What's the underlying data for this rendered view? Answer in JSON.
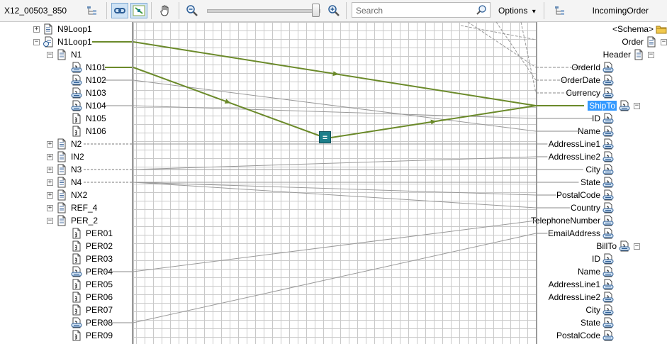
{
  "toolbar": {
    "source_schema": "X12_00503_850",
    "target_schema": "IncomingOrder",
    "search_placeholder": "Search",
    "options_label": "Options",
    "options_caret": "▾"
  },
  "source_tree": [
    {
      "label": "N9Loop1",
      "expander": "+",
      "icon": "record-icon"
    },
    {
      "label": "N1Loop1",
      "expander": "−",
      "icon": "loop-record-icon"
    },
    {
      "label": "N1",
      "expander": "−",
      "icon": "record-icon"
    },
    {
      "label": "N101",
      "expander": "",
      "icon": "linked-field-icon"
    },
    {
      "label": "N102",
      "expander": "",
      "icon": "linked-field-icon"
    },
    {
      "label": "N103",
      "expander": "",
      "icon": "linked-field-icon"
    },
    {
      "label": "N104",
      "expander": "",
      "icon": "linked-field-icon"
    },
    {
      "label": "N105",
      "expander": "",
      "icon": "field-icon"
    },
    {
      "label": "N106",
      "expander": "",
      "icon": "field-icon"
    },
    {
      "label": "N2",
      "expander": "+",
      "icon": "record-icon"
    },
    {
      "label": "IN2",
      "expander": "+",
      "icon": "record-icon"
    },
    {
      "label": "N3",
      "expander": "+",
      "icon": "record-icon"
    },
    {
      "label": "N4",
      "expander": "+",
      "icon": "record-icon"
    },
    {
      "label": "NX2",
      "expander": "+",
      "icon": "record-icon"
    },
    {
      "label": "REF_4",
      "expander": "+",
      "icon": "record-icon"
    },
    {
      "label": "PER_2",
      "expander": "−",
      "icon": "record-icon"
    },
    {
      "label": "PER01",
      "expander": "",
      "icon": "field-icon"
    },
    {
      "label": "PER02",
      "expander": "",
      "icon": "field-icon"
    },
    {
      "label": "PER03",
      "expander": "",
      "icon": "field-icon"
    },
    {
      "label": "PER04",
      "expander": "",
      "icon": "linked-field-icon"
    },
    {
      "label": "PER05",
      "expander": "",
      "icon": "field-icon"
    },
    {
      "label": "PER06",
      "expander": "",
      "icon": "field-icon"
    },
    {
      "label": "PER07",
      "expander": "",
      "icon": "field-icon"
    },
    {
      "label": "PER08",
      "expander": "",
      "icon": "linked-field-icon"
    },
    {
      "label": "PER09",
      "expander": "",
      "icon": "field-icon"
    }
  ],
  "target_tree": [
    {
      "label": "<Schema>",
      "kind": "schema",
      "expander": ""
    },
    {
      "label": "Order",
      "kind": "record",
      "expander": "−"
    },
    {
      "label": "Header",
      "kind": "record",
      "expander": "−"
    },
    {
      "label": "OrderId",
      "kind": "field",
      "expander": ""
    },
    {
      "label": "OrderDate",
      "kind": "field",
      "expander": ""
    },
    {
      "label": "Currency",
      "kind": "field",
      "expander": ""
    },
    {
      "label": "ShipTo",
      "kind": "field",
      "expander": "−",
      "selected": true
    },
    {
      "label": "ID",
      "kind": "field",
      "expander": ""
    },
    {
      "label": "Name",
      "kind": "field",
      "expander": ""
    },
    {
      "label": "AddressLine1",
      "kind": "field",
      "expander": ""
    },
    {
      "label": "AddressLine2",
      "kind": "field",
      "expander": ""
    },
    {
      "label": "City",
      "kind": "field",
      "expander": ""
    },
    {
      "label": "State",
      "kind": "field",
      "expander": ""
    },
    {
      "label": "PostalCode",
      "kind": "field",
      "expander": ""
    },
    {
      "label": "Country",
      "kind": "field",
      "expander": ""
    },
    {
      "label": "TelephoneNumber",
      "kind": "field",
      "expander": ""
    },
    {
      "label": "EmailAddress",
      "kind": "field",
      "expander": ""
    },
    {
      "label": "BillTo",
      "kind": "field",
      "expander": "−"
    },
    {
      "label": "ID",
      "kind": "field",
      "expander": ""
    },
    {
      "label": "Name",
      "kind": "field",
      "expander": ""
    },
    {
      "label": "AddressLine1",
      "kind": "field",
      "expander": ""
    },
    {
      "label": "AddressLine2",
      "kind": "field",
      "expander": ""
    },
    {
      "label": "City",
      "kind": "field",
      "expander": ""
    },
    {
      "label": "State",
      "kind": "field",
      "expander": ""
    },
    {
      "label": "PostalCode",
      "kind": "field",
      "expander": ""
    }
  ],
  "functoid_symbol": "=",
  "colors": {
    "link_selected": "#6b8a2a",
    "link_normal": "#9a9a9a",
    "selection": "#3399ff",
    "functoid": "#1d7e8a"
  }
}
